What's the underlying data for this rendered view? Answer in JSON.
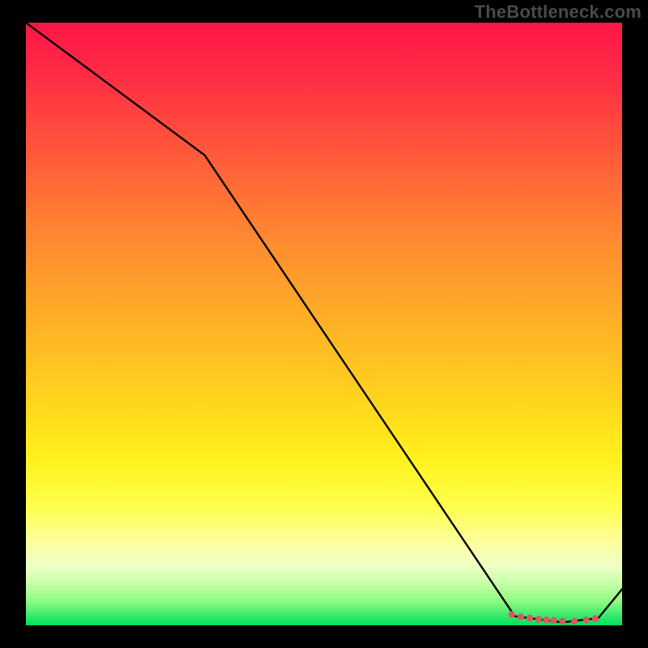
{
  "watermark": "TheBottleneck.com",
  "chart_data": {
    "type": "line",
    "title": "",
    "xlabel": "",
    "ylabel": "",
    "xlim": [
      0,
      100
    ],
    "ylim": [
      0,
      100
    ],
    "grid": false,
    "series": [
      {
        "name": "curve",
        "color": "#000000",
        "x": [
          0,
          30,
          82,
          90,
          96,
          100
        ],
        "y": [
          100,
          78,
          1.5,
          0.5,
          1.2,
          6
        ]
      }
    ],
    "markers": {
      "name": "bottom-cluster",
      "color": "#d85a5a",
      "points": [
        {
          "x": 81.5,
          "y": 1.8
        },
        {
          "x": 83.0,
          "y": 1.4
        },
        {
          "x": 84.5,
          "y": 1.2
        },
        {
          "x": 86.0,
          "y": 1.0
        },
        {
          "x": 87.3,
          "y": 0.9
        },
        {
          "x": 88.5,
          "y": 0.8
        },
        {
          "x": 90.0,
          "y": 0.7
        },
        {
          "x": 92.0,
          "y": 0.7
        },
        {
          "x": 94.0,
          "y": 0.9
        },
        {
          "x": 95.5,
          "y": 1.1
        }
      ]
    },
    "background_gradient": {
      "top": "#ff1646",
      "mid_upper": "#ff8a30",
      "mid": "#ffd21e",
      "mid_lower": "#fcff9a",
      "bottom": "#00e05c"
    }
  }
}
